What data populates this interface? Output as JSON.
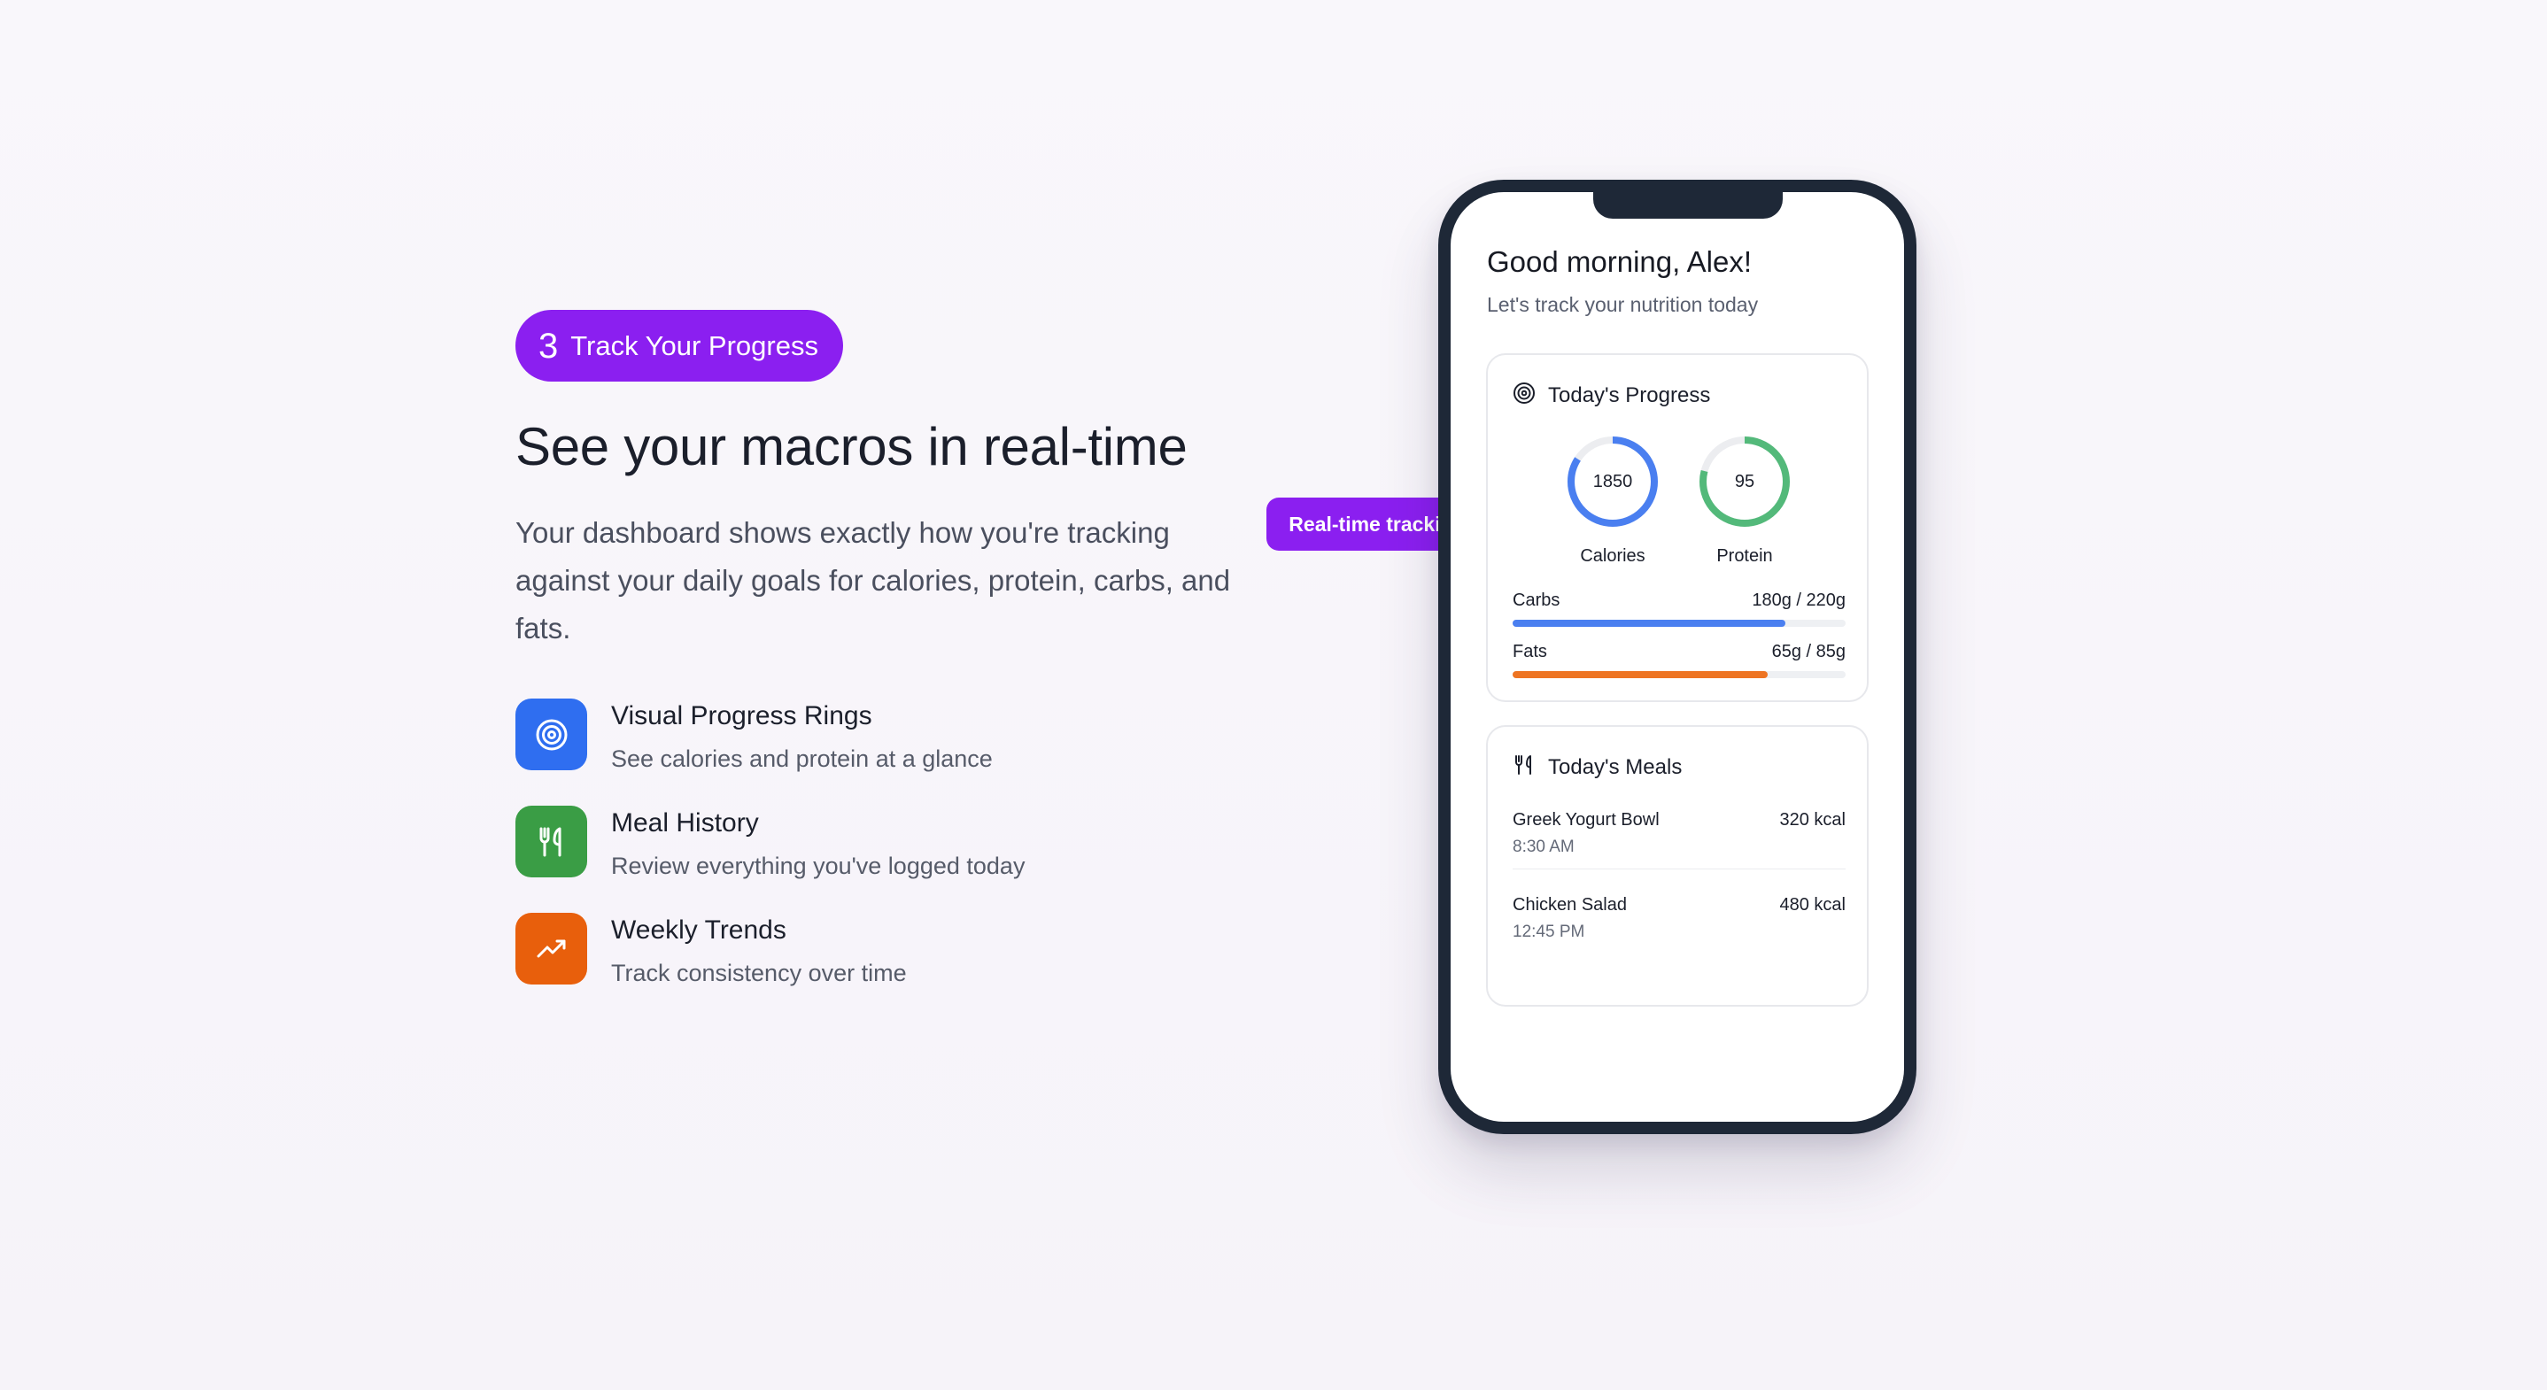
{
  "step": {
    "number": "3",
    "label": "Track Your Progress",
    "color": "#8b1ff0"
  },
  "headline": "See your macros in real-time",
  "description": "Your dashboard shows exactly how you're tracking against your daily goals for calories, protein, carbs, and fats.",
  "features": [
    {
      "title": "Visual Progress Rings",
      "subtitle": "See calories and protein at a glance",
      "icon": "target-icon",
      "color": "#2f6ef0"
    },
    {
      "title": "Meal History",
      "subtitle": "Review everything you've logged today",
      "icon": "utensils-icon",
      "color": "#3a9d45"
    },
    {
      "title": "Weekly Trends",
      "subtitle": "Track consistency over time",
      "icon": "trending-up-icon",
      "color": "#e85f0c"
    }
  ],
  "tooltip": "Real-time tracking",
  "phone": {
    "greeting": "Good morning, Alex!",
    "greeting_sub": "Let's track your nutrition today",
    "progress_card": {
      "title": "Today's Progress",
      "icon": "target-icon",
      "rings": [
        {
          "value": "1850",
          "label": "Calories",
          "fraction": 0.84,
          "color": "#4a7ff0"
        },
        {
          "value": "95",
          "label": "Protein",
          "fraction": 0.79,
          "color": "#53b97a"
        }
      ],
      "macros": [
        {
          "name": "Carbs",
          "amount": "180g / 220g",
          "fraction": 0.818,
          "color": "#4a7ff0"
        },
        {
          "name": "Fats",
          "amount": "65g / 85g",
          "fraction": 0.765,
          "color": "#ee7422"
        }
      ]
    },
    "meals_card": {
      "title": "Today's Meals",
      "icon": "utensils-icon",
      "meals": [
        {
          "name": "Greek Yogurt Bowl",
          "kcal": "320 kcal",
          "time": "8:30 AM"
        },
        {
          "name": "Chicken Salad",
          "kcal": "480 kcal",
          "time": "12:45 PM"
        }
      ]
    }
  }
}
